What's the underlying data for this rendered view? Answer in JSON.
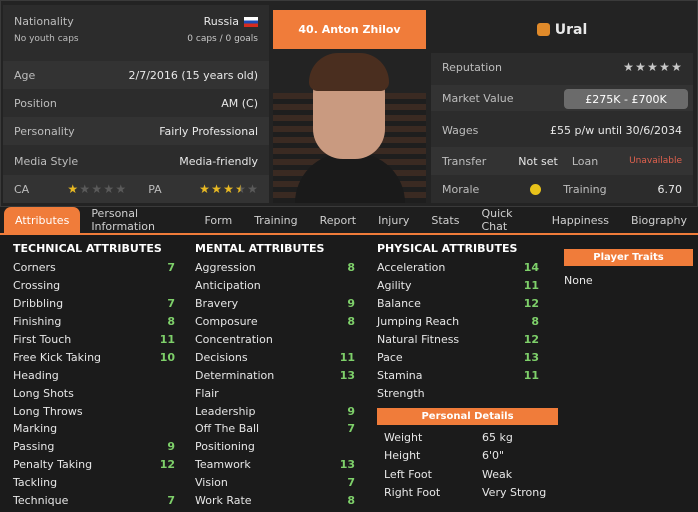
{
  "player": {
    "name": "40. Anton Zhilov",
    "club": "Ural"
  },
  "left": {
    "nationality_label": "Nationality",
    "nationality": "Russia",
    "youth_label": "No youth caps",
    "caps": "0 caps / 0 goals",
    "age_label": "Age",
    "age": "2/7/2016 (15 years old)",
    "position_label": "Position",
    "position": "AM (C)",
    "personality_label": "Personality",
    "personality": "Fairly Professional",
    "media_label": "Media Style",
    "media": "Media-friendly",
    "ca_label": "CA",
    "ca_stars": 1,
    "pa_label": "PA",
    "pa_stars": 3.5
  },
  "right": {
    "reputation_label": "Reputation",
    "reputation_stars": 0,
    "market_label": "Market Value",
    "market_value": "£275K - £700K",
    "wages_label": "Wages",
    "wages": "£55 p/w until 30/6/2034",
    "transfer_label": "Transfer",
    "transfer": "Not set",
    "loan_label": "Loan",
    "loan": "Unavailable",
    "morale_label": "Morale",
    "training_label": "Training",
    "training": "6.70"
  },
  "tabs": [
    "Attributes",
    "Personal Information",
    "Form",
    "Training",
    "Report",
    "Injury",
    "Stats",
    "Quick Chat",
    "Happiness",
    "Biography"
  ],
  "technical": {
    "title": "TECHNICAL ATTRIBUTES",
    "items": [
      [
        "Corners",
        "7"
      ],
      [
        "Crossing",
        ""
      ],
      [
        "Dribbling",
        "7"
      ],
      [
        "Finishing",
        "8"
      ],
      [
        "First Touch",
        "11"
      ],
      [
        "Free Kick Taking",
        "10"
      ],
      [
        "Heading",
        ""
      ],
      [
        "Long Shots",
        ""
      ],
      [
        "Long Throws",
        ""
      ],
      [
        "Marking",
        ""
      ],
      [
        "Passing",
        "9"
      ],
      [
        "Penalty Taking",
        "12"
      ],
      [
        "Tackling",
        ""
      ],
      [
        "Technique",
        "7"
      ]
    ]
  },
  "mental": {
    "title": "MENTAL ATTRIBUTES",
    "items": [
      [
        "Aggression",
        "8"
      ],
      [
        "Anticipation",
        ""
      ],
      [
        "Bravery",
        "9"
      ],
      [
        "Composure",
        "8"
      ],
      [
        "Concentration",
        ""
      ],
      [
        "Decisions",
        "11"
      ],
      [
        "Determination",
        "13"
      ],
      [
        "Flair",
        ""
      ],
      [
        "Leadership",
        "9"
      ],
      [
        "Off The Ball",
        "7"
      ],
      [
        "Positioning",
        ""
      ],
      [
        "Teamwork",
        "13"
      ],
      [
        "Vision",
        "7"
      ],
      [
        "Work Rate",
        "8"
      ]
    ]
  },
  "physical": {
    "title": "PHYSICAL ATTRIBUTES",
    "items": [
      [
        "Acceleration",
        "14"
      ],
      [
        "Agility",
        "11"
      ],
      [
        "Balance",
        "12"
      ],
      [
        "Jumping Reach",
        "8"
      ],
      [
        "Natural Fitness",
        "12"
      ],
      [
        "Pace",
        "13"
      ],
      [
        "Stamina",
        "11"
      ],
      [
        "Strength",
        ""
      ]
    ]
  },
  "personal": {
    "title": "Personal Details",
    "items": [
      [
        "Weight",
        "65 kg"
      ],
      [
        "Height",
        "6'0\""
      ],
      [
        "Left Foot",
        "Weak"
      ],
      [
        "Right Foot",
        "Very Strong"
      ]
    ]
  },
  "traits": {
    "title": "Player Traits",
    "value": "None"
  }
}
